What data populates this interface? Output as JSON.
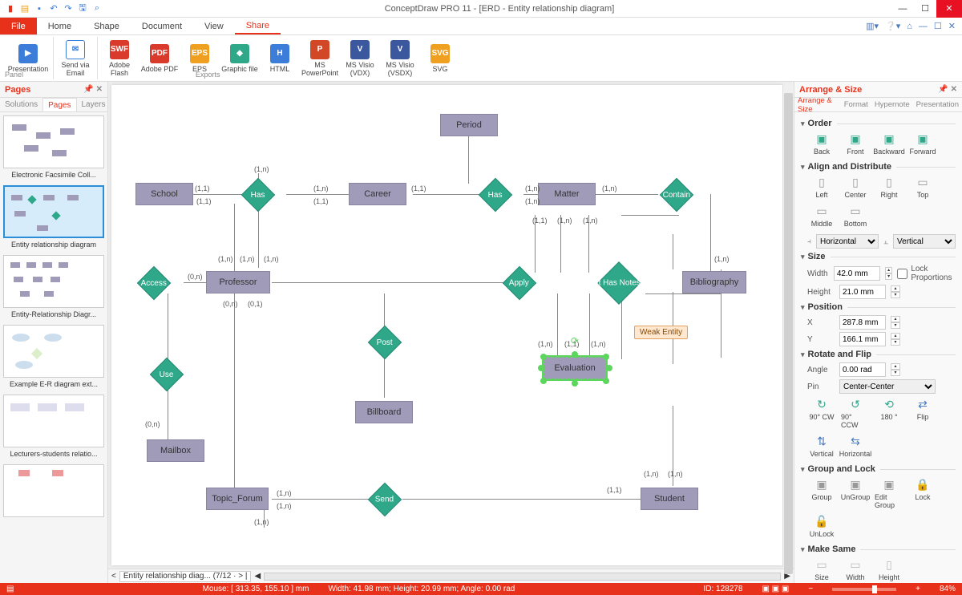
{
  "window": {
    "title": "ConceptDraw PRO 11 - [ERD - Entity relationship diagram]"
  },
  "menu": {
    "tabs": [
      "File",
      "Home",
      "Shape",
      "Document",
      "View",
      "Share"
    ],
    "active": "Share"
  },
  "ribbon": {
    "items": [
      {
        "label": "Presentation",
        "sub": "",
        "color": "#3b7dd8"
      },
      {
        "label": "Send via Email",
        "sub": "Email",
        "color": "#3b7dd8"
      },
      {
        "label": "Adobe Flash",
        "sub": "",
        "color": "#d93a2b"
      },
      {
        "label": "Adobe PDF",
        "sub": "",
        "color": "#d93a2b"
      },
      {
        "label": "EPS",
        "sub": "",
        "color": "#f0a020"
      },
      {
        "label": "Graphic file",
        "sub": "",
        "color": "#2fa88a"
      },
      {
        "label": "HTML",
        "sub": "",
        "color": "#3b7dd8"
      },
      {
        "label": "MS PowerPoint",
        "sub": "",
        "color": "#d24726"
      },
      {
        "label": "MS Visio (VDX)",
        "sub": "",
        "color": "#3b579d"
      },
      {
        "label": "MS Visio (VSDX)",
        "sub": "",
        "color": "#3b579d"
      },
      {
        "label": "SVG",
        "sub": "",
        "color": "#f0a020"
      }
    ],
    "group1": "Panel",
    "group2": "Exports"
  },
  "pages_panel": {
    "title": "Pages",
    "subtabs": [
      "Solutions",
      "Pages",
      "Layers"
    ],
    "active_subtab": "Pages",
    "thumbs": [
      {
        "label": "Electronic Facsimile Coll..."
      },
      {
        "label": "Entity relationship diagram"
      },
      {
        "label": "Entity-Relationship Diagr..."
      },
      {
        "label": "Example E-R diagram ext..."
      },
      {
        "label": "Lecturers-students relatio..."
      }
    ],
    "active_thumb": 1
  },
  "diagram": {
    "entities": {
      "school": "School",
      "career": "Career",
      "period": "Period",
      "matter": "Matter",
      "professor": "Professor",
      "bibliography": "Bibliography",
      "evaluation": "Evaluation",
      "billboard": "Billboard",
      "mailbox": "Mailbox",
      "topic_forum": "Topic_Forum",
      "student": "Student"
    },
    "relationships": {
      "has1": "Has",
      "has2": "Has",
      "contain": "Contain",
      "access": "Access",
      "apply": "Apply",
      "ithasnotes": "It Has Notes",
      "use": "Use",
      "post": "Post",
      "send": "Send"
    },
    "cards": {
      "c_1n": "(1,n)",
      "c_11": "(1,1)",
      "c_0n": "(0,n)",
      "c_01": "(0,1)"
    },
    "tooltip": "Weak Entity"
  },
  "canvas_footer": {
    "doc_tab": "Entity relationship diag... (7/12"
  },
  "right_panel": {
    "title": "Arrange & Size",
    "tabs": [
      "Arrange & Size",
      "Format",
      "Hypernote",
      "Presentation"
    ],
    "sections": {
      "order": "Order",
      "align": "Align and Distribute",
      "size": "Size",
      "position": "Position",
      "rotate": "Rotate and Flip",
      "group": "Group and Lock",
      "makesame": "Make Same"
    },
    "order_btns": [
      "Back",
      "Front",
      "Backward",
      "Forward"
    ],
    "align_btns": [
      "Left",
      "Center",
      "Right",
      "Top",
      "Middle",
      "Bottom"
    ],
    "align_combo1": "Horizontal",
    "align_combo2": "Vertical",
    "size": {
      "width_label": "Width",
      "width": "42.0 mm",
      "height_label": "Height",
      "height": "21.0 mm",
      "lock": "Lock Proportions"
    },
    "position": {
      "x": "287.8 mm",
      "y": "166.1 mm"
    },
    "rotate": {
      "angle_label": "Angle",
      "angle": "0.00 rad",
      "pin_label": "Pin",
      "pin": "Center-Center",
      "btns": [
        "90° CW",
        "90° CCW",
        "180 °",
        "Flip",
        "Vertical",
        "Horizontal"
      ]
    },
    "group_btns": [
      "Group",
      "UnGroup",
      "Edit Group",
      "Lock",
      "UnLock"
    ],
    "makesame_btns": [
      "Size",
      "Width",
      "Height"
    ]
  },
  "statusbar": {
    "mouse": "Mouse: [ 313.35, 155.10 ]  mm",
    "dims": "Width: 41.98 mm;   Height: 20.99 mm;   Angle: 0.00 rad",
    "id": "ID: 128278",
    "zoom": "84%"
  }
}
